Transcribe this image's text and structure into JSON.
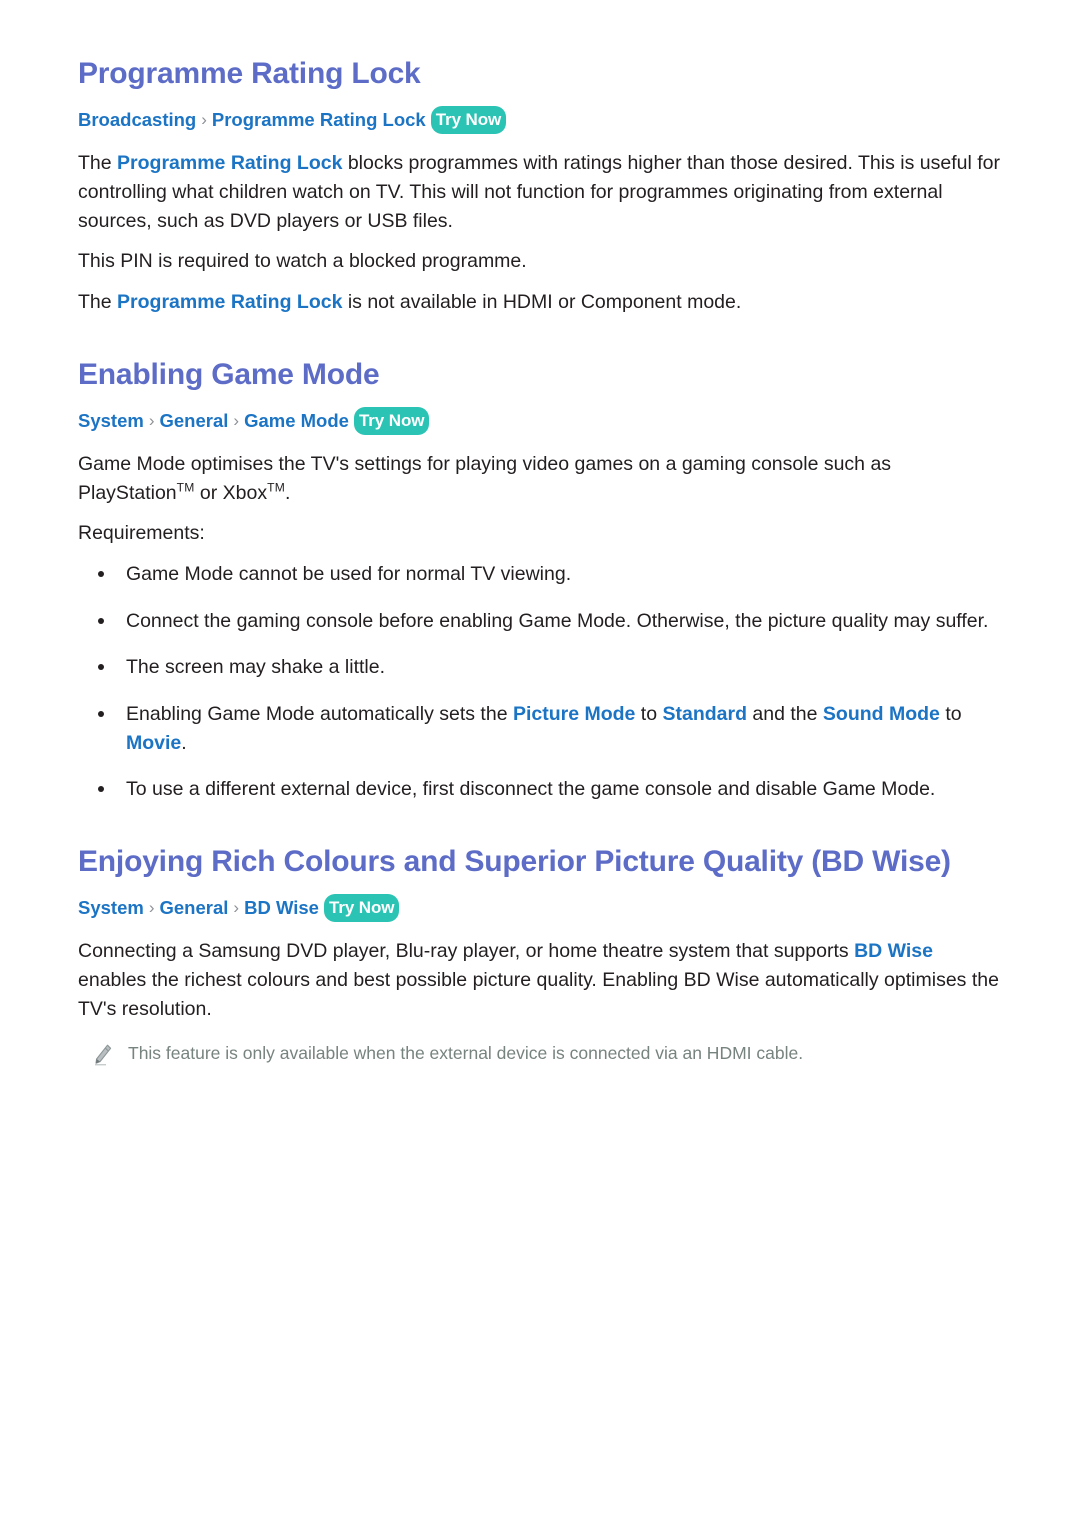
{
  "document": {
    "sections": [
      {
        "id": "programme-rating-lock",
        "title": "Programme Rating Lock",
        "breadcrumb": {
          "crumbs": [
            "Broadcasting",
            "Programme Rating Lock"
          ],
          "separator": "›",
          "try_now_label": "Try Now"
        },
        "paragraphs": [
          {
            "parts": [
              {
                "text": "The ",
                "style": "normal"
              },
              {
                "text": "Programme Rating Lock",
                "style": "highlight"
              },
              {
                "text": " blocks programmes with ratings higher than those desired. This is useful for controlling what children watch on TV. This will not function for programmes originating from external sources, such as DVD players or USB files.",
                "style": "normal"
              }
            ]
          },
          {
            "parts": [
              {
                "text": "This PIN is required to watch a blocked programme.",
                "style": "normal"
              }
            ]
          },
          {
            "parts": [
              {
                "text": "The ",
                "style": "normal"
              },
              {
                "text": "Programme Rating Lock",
                "style": "highlight"
              },
              {
                "text": " is not available in HDMI or Component mode.",
                "style": "normal"
              }
            ]
          }
        ]
      },
      {
        "id": "enabling-game-mode",
        "title": "Enabling Game Mode",
        "breadcrumb": {
          "crumbs": [
            "System",
            "General",
            "Game Mode"
          ],
          "separator": "›",
          "try_now_label": "Try Now"
        },
        "paragraphs": [
          {
            "parts": [
              {
                "text": "Game Mode optimises the TV's settings for playing video games on a gaming console such as PlayStation",
                "style": "normal"
              },
              {
                "text": "TM",
                "style": "trademark"
              },
              {
                "text": " or Xbox",
                "style": "normal"
              },
              {
                "text": "TM",
                "style": "trademark"
              },
              {
                "text": ".",
                "style": "normal"
              }
            ]
          },
          {
            "parts": [
              {
                "text": "Requirements:",
                "style": "normal"
              }
            ]
          }
        ],
        "bullets": [
          {
            "parts": [
              {
                "text": "Game Mode cannot be used for normal TV viewing.",
                "style": "normal"
              }
            ]
          },
          {
            "parts": [
              {
                "text": "Connect the gaming console before enabling Game Mode. Otherwise, the picture quality may suffer.",
                "style": "normal"
              }
            ]
          },
          {
            "parts": [
              {
                "text": "The screen may shake a little.",
                "style": "normal"
              }
            ]
          },
          {
            "parts": [
              {
                "text": "Enabling Game Mode automatically sets the ",
                "style": "normal"
              },
              {
                "text": "Picture Mode",
                "style": "highlight"
              },
              {
                "text": " to ",
                "style": "normal"
              },
              {
                "text": "Standard",
                "style": "highlight"
              },
              {
                "text": " and the ",
                "style": "normal"
              },
              {
                "text": "Sound Mode",
                "style": "highlight"
              },
              {
                "text": " to ",
                "style": "normal"
              },
              {
                "text": "Movie",
                "style": "highlight"
              },
              {
                "text": ".",
                "style": "normal"
              }
            ]
          },
          {
            "parts": [
              {
                "text": "To use a different external device, first disconnect the game console and disable Game Mode.",
                "style": "normal"
              }
            ]
          }
        ]
      },
      {
        "id": "bd-wise",
        "title": "Enjoying Rich Colours and Superior Picture Quality (BD Wise)",
        "breadcrumb": {
          "crumbs": [
            "System",
            "General",
            "BD Wise"
          ],
          "separator": "›",
          "try_now_label": "Try Now"
        },
        "paragraphs": [
          {
            "parts": [
              {
                "text": "Connecting a Samsung DVD player, Blu-ray player, or home theatre system that supports ",
                "style": "normal"
              },
              {
                "text": "BD Wise",
                "style": "highlight"
              },
              {
                "text": " enables the richest colours and best possible picture quality. Enabling BD Wise automatically optimises the TV's resolution.",
                "style": "normal"
              }
            ]
          }
        ],
        "note": {
          "icon": "pencil-icon",
          "text": "This feature is only available when the external device is connected via an HDMI cable."
        }
      }
    ]
  },
  "colors": {
    "heading": "#5d6cc6",
    "link": "#1c74c4",
    "try_now_background": "#2bc4b4",
    "try_now_text": "#ffffff",
    "body_text": "#231f20",
    "note_text": "#77837e",
    "separator": "#8d9196"
  }
}
